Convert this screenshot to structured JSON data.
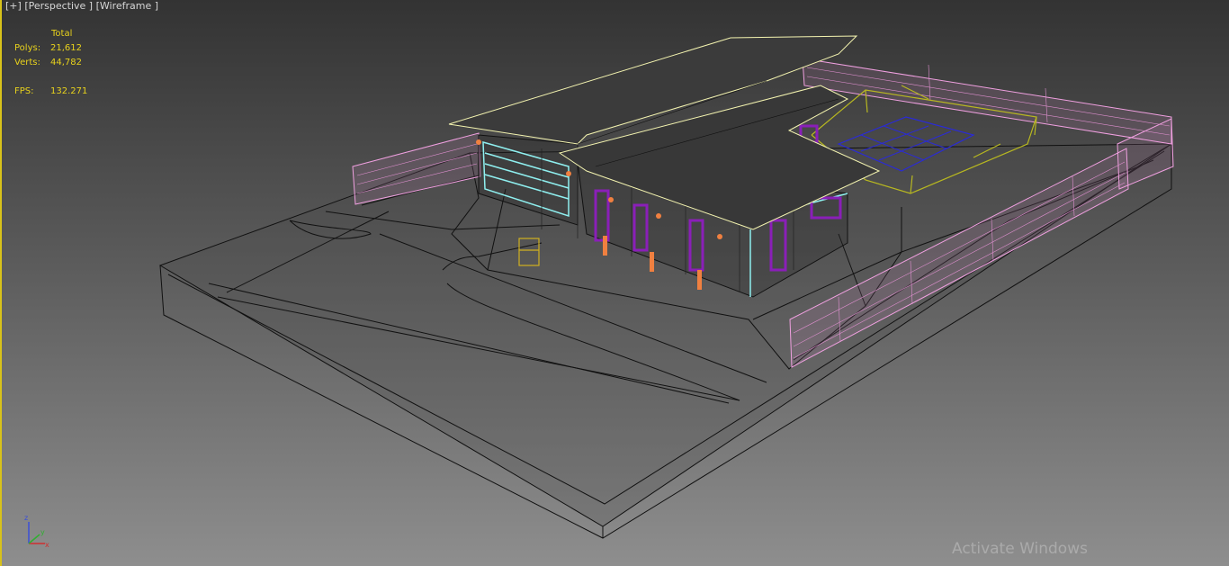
{
  "viewport": {
    "labels": {
      "plus": "[+]",
      "view": "[Perspective ]",
      "shading": "[Wireframe ]"
    },
    "stats": {
      "total_label": "Total",
      "polys_label": "Polys:",
      "polys_value": "21,612",
      "verts_label": "Verts:",
      "verts_value": "44,782",
      "fps_label": "FPS:",
      "fps_value": "132.271"
    },
    "axis": {
      "x": "x",
      "y": "y",
      "z": "z"
    },
    "watermark": "Activate Windows"
  },
  "colors": {
    "stats_text": "#e8d21c",
    "border_active": "#d8c21a",
    "fence": "#f0a0e0",
    "roof": "#3a3a3a",
    "window_frames": "#8a1fb8",
    "garage_door": "#8ff0f0",
    "pool_grid": "#2a2ad8",
    "pool_fence": "#b8b820",
    "posts": "#f08040",
    "wire": "#111111"
  }
}
